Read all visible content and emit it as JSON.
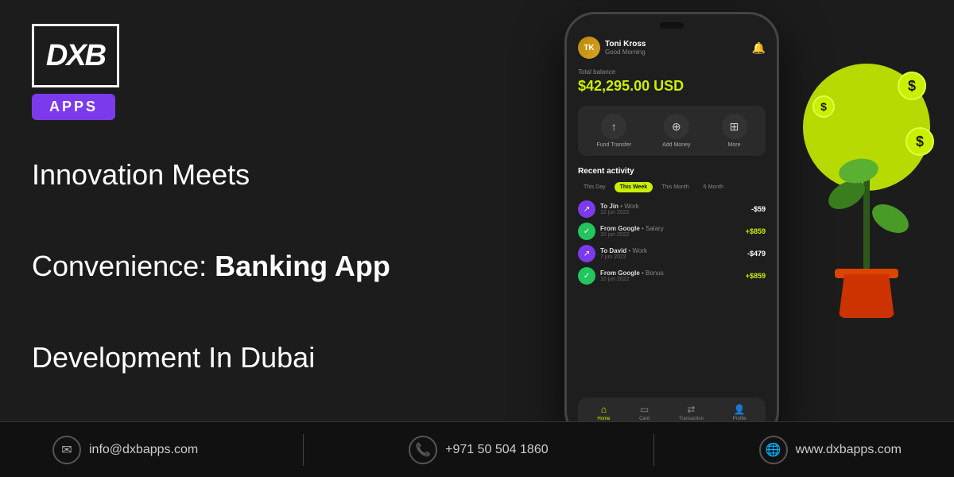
{
  "brand": {
    "logo_text": "DXB",
    "apps_label": "APPS"
  },
  "headline": {
    "line1": "Innovation Meets",
    "line2": "Convenience: ",
    "line2_bold": "Banking App",
    "line3": "Development In Dubai"
  },
  "phone": {
    "user_name": "Toni Kross",
    "greeting": "Good Morning",
    "balance_label": "Total balance",
    "balance_amount": "$42,295.00 USD",
    "actions": [
      {
        "label": "Fund Transfer",
        "icon": "↑"
      },
      {
        "label": "Add Money",
        "icon": "+"
      },
      {
        "label": "More",
        "icon": "⋮⋮"
      }
    ],
    "recent_activity_label": "Recent activity",
    "tabs": [
      "This Day",
      "This Week",
      "This Month",
      "6 Month"
    ],
    "active_tab": "This Week",
    "transactions": [
      {
        "name": "To Jin",
        "category": "Work",
        "date": "12 jun 2022",
        "amount": "-$59",
        "type": "negative",
        "icon": "↗",
        "icon_style": "purple"
      },
      {
        "name": "From Google",
        "category": "Salary",
        "date": "10 jun 2022",
        "amount": "+$859",
        "type": "positive",
        "icon": "✓",
        "icon_style": "green"
      },
      {
        "name": "To David",
        "category": "Work",
        "date": "7 jun 2022",
        "amount": "-$479",
        "type": "negative",
        "icon": "↗",
        "icon_style": "purple"
      },
      {
        "name": "From Google",
        "category": "Bonus",
        "date": "10 jun 2022",
        "amount": "+$859",
        "type": "positive",
        "icon": "✓",
        "icon_style": "green"
      }
    ],
    "nav": [
      {
        "label": "Home",
        "icon": "⌂",
        "active": true
      },
      {
        "label": "Card",
        "icon": "▭",
        "active": false
      },
      {
        "label": "Transaction",
        "icon": "⇄",
        "active": false
      },
      {
        "label": "Profile",
        "icon": "👤",
        "active": false
      }
    ]
  },
  "footer": {
    "email": "info@dxbapps.com",
    "phone": "+971 50 504 1860",
    "website": "www.dxbapps.com"
  },
  "decoration": {
    "dollar_symbol": "$"
  }
}
